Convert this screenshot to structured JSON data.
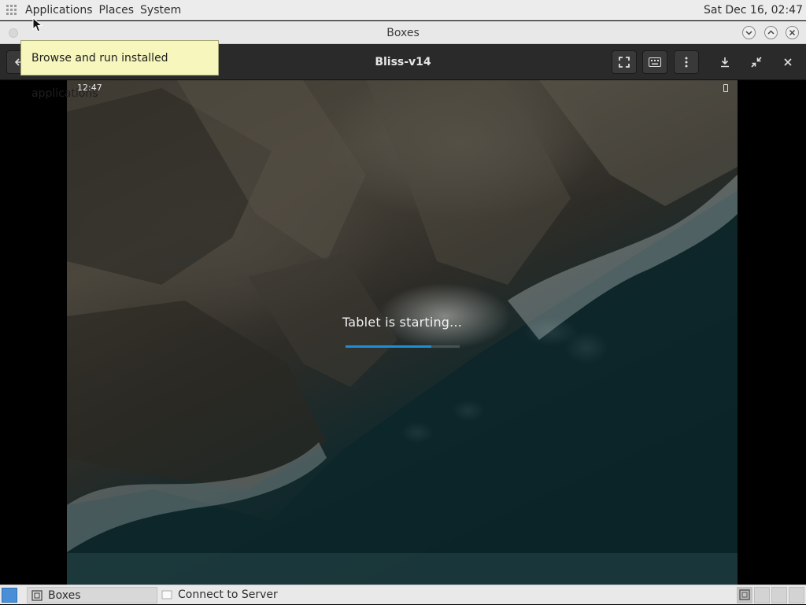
{
  "top_panel": {
    "menus": [
      "Applications",
      "Places",
      "System"
    ],
    "clock": "Sat Dec 16, 02:47"
  },
  "window": {
    "title": "Boxes"
  },
  "header": {
    "vm_name": "Bliss-v14"
  },
  "tooltip": {
    "text": "Browse and run installed applications"
  },
  "vm": {
    "status_time": "12:47",
    "boot_message": "Tablet is starting...",
    "progress": 0.75
  },
  "taskbar": {
    "tasks": [
      {
        "label": "Boxes",
        "icon": "boxes-icon",
        "active": true
      },
      {
        "label": "Connect to Server",
        "icon": "folder-icon",
        "active": false
      }
    ]
  },
  "colors": {
    "tooltip_bg": "#f6f6bd",
    "header_bg": "#2a2a2a",
    "progress": "#1e8fd6",
    "show_desktop": "#4a8ed8"
  }
}
